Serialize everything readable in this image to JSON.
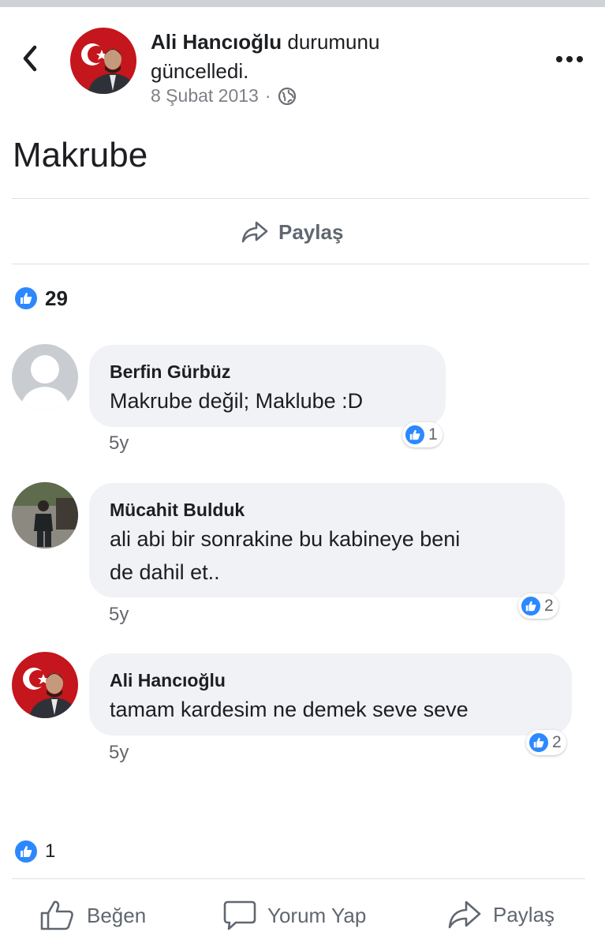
{
  "post": {
    "author": "Ali Hancıoğlu",
    "action": "durumunu güncelledi.",
    "date": "8 Şubat 2013",
    "separator": "·",
    "text": "Makrube",
    "share_label": "Paylaş",
    "like_count": "29"
  },
  "comments": [
    {
      "name": "Berfin Gürbüz",
      "lines": [
        "Makrube değil; Maklube :D"
      ],
      "time": "5y",
      "reactions": "1"
    },
    {
      "name": "Mücahit Bulduk",
      "lines": [
        "ali abi bir sonrakine bu kabineye beni",
        "de dahil et.."
      ],
      "time": "5y",
      "reactions": "2"
    },
    {
      "name": "Ali Hancıoğlu",
      "lines": [
        "tamam kardesim ne demek seve seve"
      ],
      "time": "5y",
      "reactions": "2"
    }
  ],
  "footer": {
    "like_count": "1",
    "actions": {
      "like": "Beğen",
      "comment": "Yorum Yap",
      "share": "Paylaş"
    }
  },
  "colors": {
    "like_blue": "#2d88ff",
    "bubble": "#f0f2f5",
    "meta_gray": "#7d8187"
  },
  "icons": [
    "back-chevron-icon",
    "globe-icon",
    "more-dots-icon",
    "share-arrow-icon",
    "like-thumb-icon",
    "comment-bubble-icon"
  ]
}
